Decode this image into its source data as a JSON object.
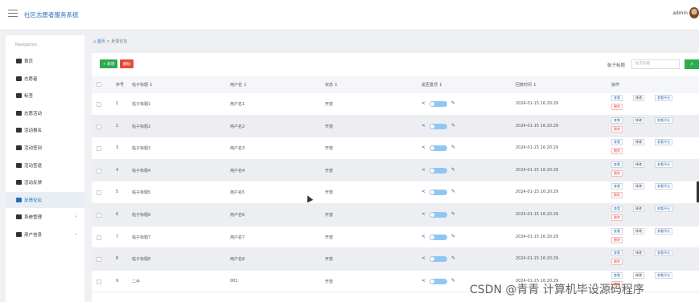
{
  "app_title": "社区志愿者服务系统",
  "user": "admin",
  "sidebar": {
    "title": "Navigation",
    "items": [
      {
        "label": "首页"
      },
      {
        "label": "志愿者"
      },
      {
        "label": "标签"
      },
      {
        "label": "志愿活动"
      },
      {
        "label": "活动报名"
      },
      {
        "label": "活动签到"
      },
      {
        "label": "活动签退"
      },
      {
        "label": "活动反馈"
      },
      {
        "label": "反馈论坛",
        "active": true
      },
      {
        "label": "系统管理",
        "chevron": true
      },
      {
        "label": "用户信息",
        "chevron": true
      }
    ]
  },
  "breadcrumb": {
    "home": "首页",
    "sep": ">",
    "current": "反馈论坛"
  },
  "toolbar": {
    "add_label": "+ 新增",
    "delete_label": "删除"
  },
  "search": {
    "label": "帖子标题",
    "placeholder": "帖子标题",
    "button_icon": "⌕"
  },
  "table": {
    "columns": [
      "",
      "序号",
      "帖子标题 ↕",
      "用户名 ↕",
      "状态 ↕",
      "是否置顶 ↕",
      "回复时间 ↕",
      "操作"
    ],
    "rows": [
      {
        "idx": "1",
        "title": "帖子标题1",
        "user": "用户名1",
        "status": "开放",
        "time": "2024-01-15 16:20:29"
      },
      {
        "idx": "2",
        "title": "帖子标题2",
        "user": "用户名2",
        "status": "开放",
        "time": "2024-01-15 16:20:29"
      },
      {
        "idx": "3",
        "title": "帖子标题3",
        "user": "用户名3",
        "status": "开放",
        "time": "2024-01-15 16:20:29"
      },
      {
        "idx": "4",
        "title": "帖子标题4",
        "user": "用户名4",
        "status": "开放",
        "time": "2024-01-15 16:20:29"
      },
      {
        "idx": "5",
        "title": "帖子标题5",
        "user": "用户名5",
        "status": "开放",
        "time": "2024-01-15 16:20:29"
      },
      {
        "idx": "6",
        "title": "帖子标题6",
        "user": "用户名6",
        "status": "开放",
        "time": "2024-01-15 16:20:29"
      },
      {
        "idx": "7",
        "title": "帖子标题7",
        "user": "用户名7",
        "status": "开放",
        "time": "2024-01-15 16:20:29"
      },
      {
        "idx": "8",
        "title": "帖子标题8",
        "user": "用户名8",
        "status": "开放",
        "time": "2024-01-15 16:20:29"
      },
      {
        "idx": "9",
        "title": "二手",
        "user": "001",
        "status": "开放",
        "time": "2024-01-15 16:20:29"
      }
    ],
    "actions": {
      "view": "查看",
      "edit": "修改",
      "comments": "查看评论",
      "delete": "删除"
    }
  },
  "watermark": "CSDN @青青 计算机毕设源码程序"
}
